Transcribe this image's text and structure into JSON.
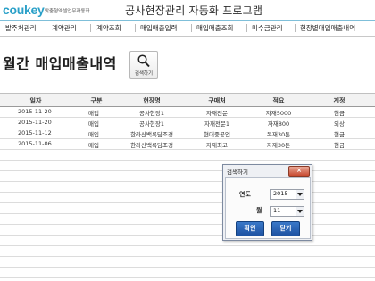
{
  "header": {
    "logo": "coukey",
    "logo_sub": "맞춤형엑셀업무자동화",
    "app_title": "공사현장관리 자동화 프로그램"
  },
  "nav": {
    "items": [
      {
        "label": "발주처관리"
      },
      {
        "label": "계약관리"
      },
      {
        "label": "계약조회"
      },
      {
        "label": "매입매출입력"
      },
      {
        "label": "매입매출조회"
      },
      {
        "label": "미수금관리"
      },
      {
        "label": "현장별매입매출내역"
      }
    ]
  },
  "page": {
    "title": "월간 매입매출내역",
    "search_button_label": "검색하기"
  },
  "table": {
    "columns": [
      "일자",
      "구분",
      "현장명",
      "구매처",
      "적요",
      "계정"
    ],
    "rows": [
      [
        "2015-11-20",
        "매입",
        "공사현장1",
        "자재전문",
        "자재5000",
        "현금"
      ],
      [
        "2015-11-20",
        "매입",
        "공사현장1",
        "자재전문1",
        "자재800",
        "외상"
      ],
      [
        "2015-11-12",
        "매입",
        "한라산백록담조경",
        "현대중공업",
        "목재30톤",
        "현금"
      ],
      [
        "2015-11-06",
        "매입",
        "한라산백록담조경",
        "자재최고",
        "자재30톤",
        "현금"
      ]
    ]
  },
  "dialog": {
    "title": "검색하기",
    "close_label": "×",
    "year_label": "연도",
    "year_value": "2015",
    "month_label": "월",
    "month_value": "11",
    "ok_label": "확인",
    "close_button_label": "닫기"
  },
  "colors": {
    "logo": "#2aa0c8",
    "accent_line": "#7fbfd9",
    "dialog_button": "#2563b4",
    "close_button": "#c84a30"
  }
}
